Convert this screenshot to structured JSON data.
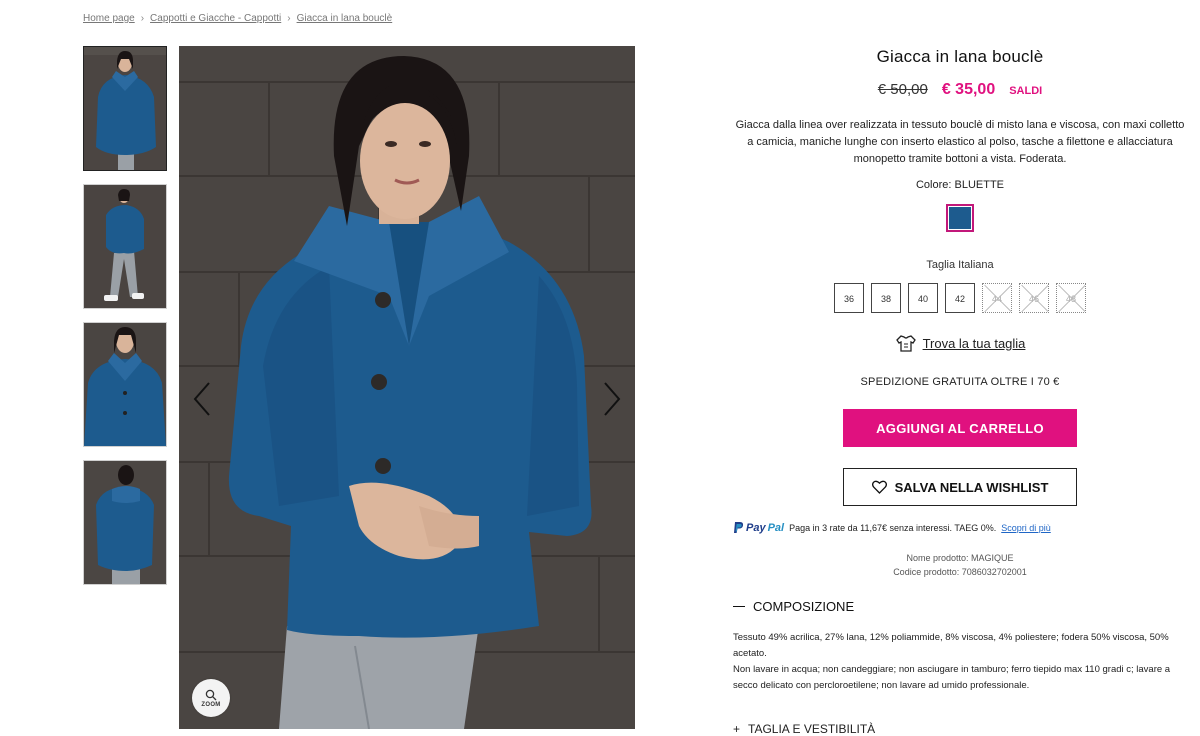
{
  "breadcrumb": [
    "Home page",
    "Cappotti e Giacche - Cappotti",
    "Giacca in lana bouclè"
  ],
  "product": {
    "title": "Giacca in lana bouclè",
    "old_price": "€ 50,00",
    "new_price": "€ 35,00",
    "sale_label": "SALDI",
    "description": "Giacca dalla linea over realizzata in tessuto bouclè di misto lana e viscosa, con maxi colletto a camicia, maniche lunghe con inserto elastico al polso, tasche a filettone e allacciatura monopetto tramite bottoni a vista. Foderata.",
    "color_label": "Colore: BLUETTE",
    "swatch_color": "#1d5b8e",
    "size_label": "Taglia Italiana",
    "sizes": [
      {
        "label": "36",
        "available": true
      },
      {
        "label": "38",
        "available": true
      },
      {
        "label": "40",
        "available": true
      },
      {
        "label": "42",
        "available": true
      },
      {
        "label": "44",
        "available": false
      },
      {
        "label": "46",
        "available": false
      },
      {
        "label": "48",
        "available": false
      }
    ],
    "find_size": "Trova la tua taglia",
    "shipping": "SPEDIZIONE GRATUITA OLTRE I 70 €",
    "add_to_cart": "AGGIUNGI AL CARRELLO",
    "wishlist": "SALVA NELLA WISHLIST",
    "paypal": {
      "logo_a": "Pay",
      "logo_b": "Pal",
      "text": "Paga in 3 rate da 11,67€ senza interessi. TAEG 0%.",
      "link": "Scopri di più"
    },
    "product_name": "Nome prodotto: MAGIQUE",
    "product_code": "Codice prodotto:  7086032702001",
    "composition_title": "COMPOSIZIONE",
    "composition_text": "Tessuto 49% acrilica, 27% lana, 12% poliammide, 8% viscosa, 4% poliestere; fodera 50% viscosa, 50% acetato.",
    "care_text": "Non lavare in acqua; non candeggiare; non asciugare in tamburo; ferro tiepido max 110 gradi c; lavare a secco delicato con percloroetilene; non lavare ad umido professionale.",
    "next_section": "TAGLIA E VESTIBILITÀ"
  },
  "gallery": {
    "zoom_label": "ZOOM",
    "thumbnail_count": 4
  },
  "colors": {
    "accent": "#e0117f",
    "jacket": "#1d5b8e",
    "background_wall": "#4a4542"
  }
}
